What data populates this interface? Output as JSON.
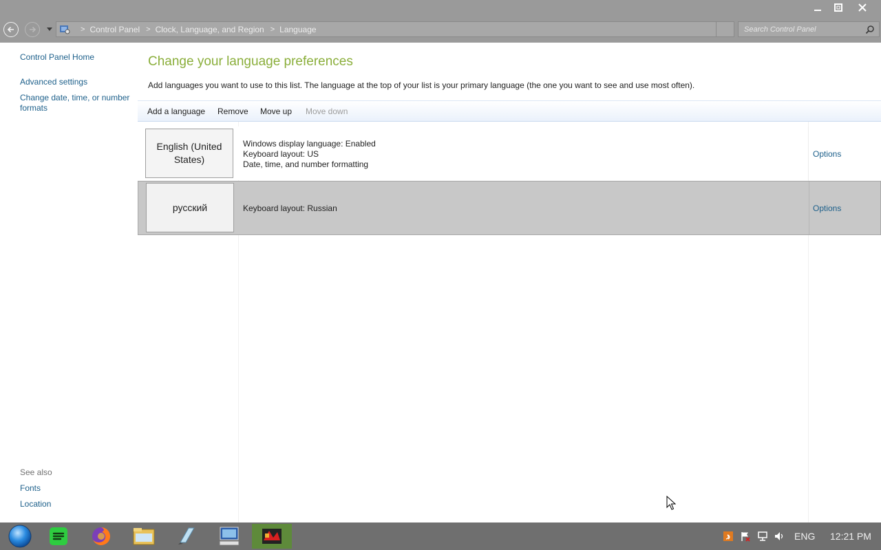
{
  "window": {
    "minimize_glyph": "—",
    "restore_glyph": "❐",
    "close_glyph": "✕"
  },
  "address": {
    "breadcrumbs": [
      "Control Panel",
      "Clock, Language, and Region",
      "Language"
    ],
    "separator": ">",
    "search_placeholder": "Search Control Panel"
  },
  "sidebar": {
    "home": "Control Panel Home",
    "links": [
      "Advanced settings",
      "Change date, time, or number formats"
    ],
    "see_also_label": "See also",
    "see_also_links": [
      "Fonts",
      "Location"
    ]
  },
  "main": {
    "title": "Change your language preferences",
    "description": "Add languages you want to use to this list. The language at the top of your list is your primary language (the one you want to see and use most often).",
    "toolbar": {
      "add": "Add a language",
      "remove": "Remove",
      "move_up": "Move up",
      "move_down": "Move down"
    },
    "languages": [
      {
        "name": "English (United States)",
        "details": [
          "Windows display language: Enabled",
          "Keyboard layout: US",
          "Date, time, and number formatting"
        ],
        "options": "Options"
      },
      {
        "name": "русский",
        "details": [
          "Keyboard layout: Russian"
        ],
        "options": "Options"
      }
    ]
  },
  "taskbar": {
    "apps": [
      "start-orb-icon",
      "spotify-icon",
      "firefox-icon",
      "file-explorer-icon",
      "notepad-icon",
      "remote-desktop-icon",
      "game-icon"
    ],
    "tray": {
      "input_language": "ENG",
      "time": "12:21 PM"
    }
  },
  "colors": {
    "title_green": "#8aae3a",
    "link_blue": "#1c5f8a",
    "selected_row": "#c8c8c8",
    "chrome_gray": "#9a9a9a",
    "taskbar_gray": "#6f6f6f"
  }
}
